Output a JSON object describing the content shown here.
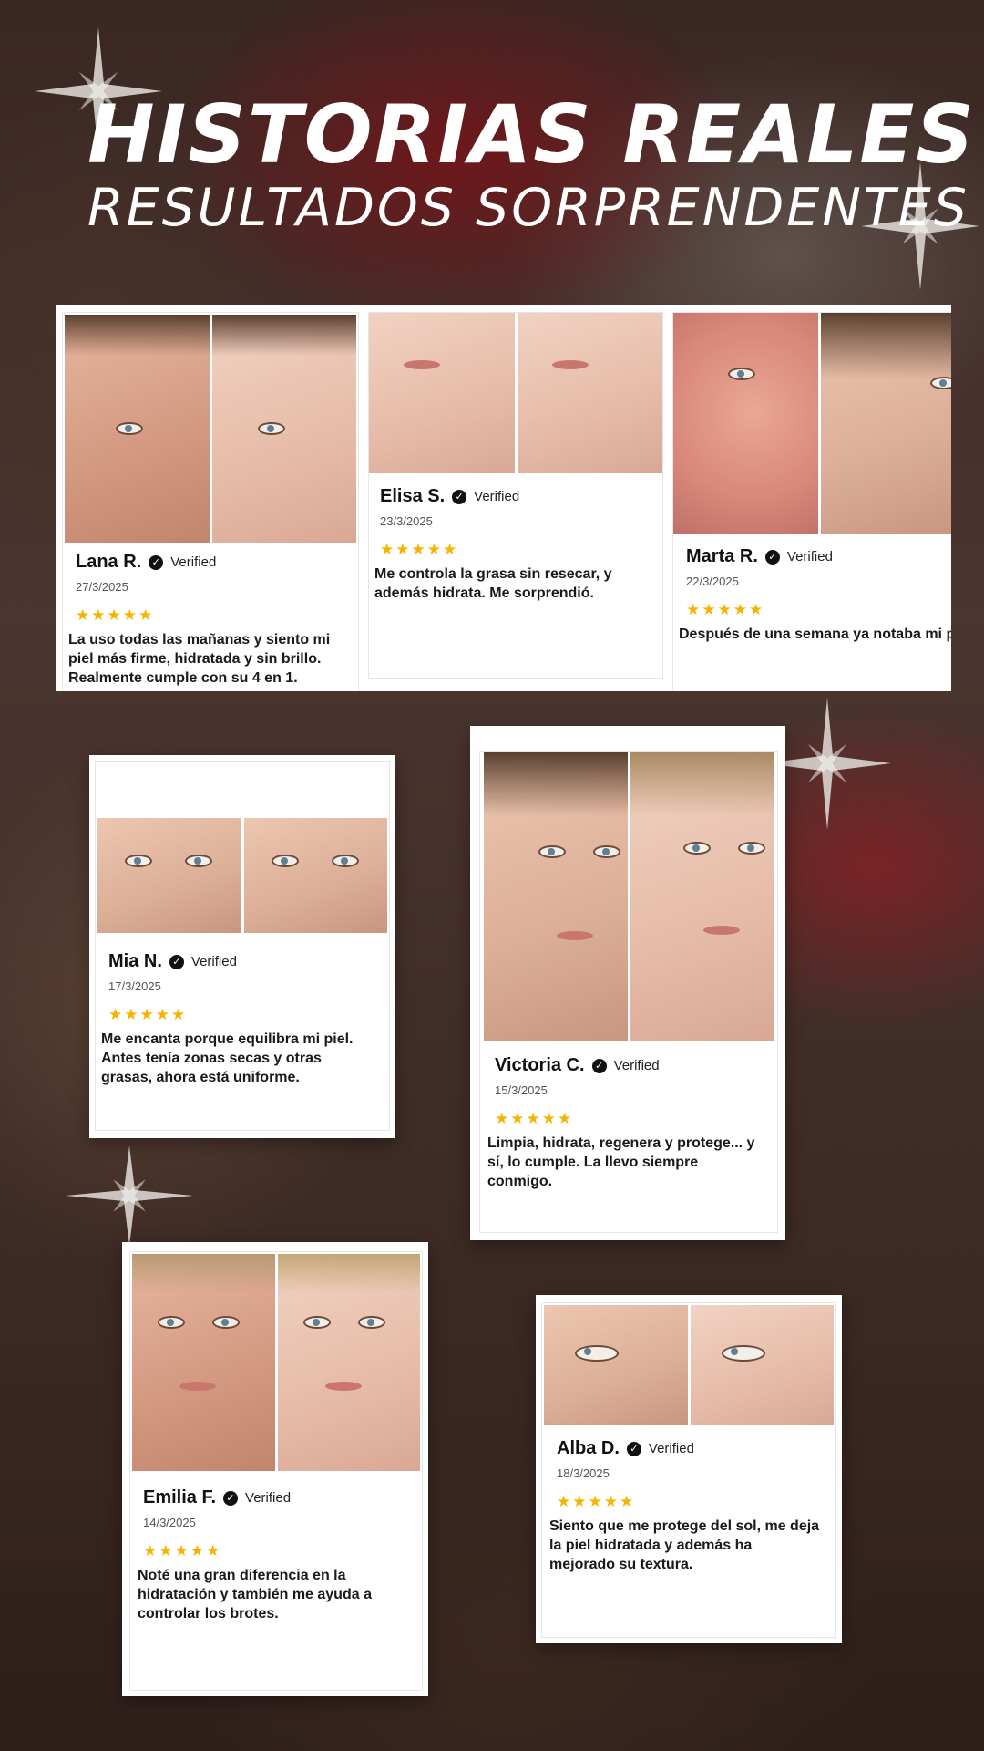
{
  "header": {
    "title": "HISTORIAS REALES",
    "subtitle": "RESULTADOS SORPRENDENTES"
  },
  "verified_label": "Verified",
  "colors": {
    "star_rating": "#f5b400",
    "title": "#ffffff",
    "card_bg": "#ffffff"
  },
  "reviews": [
    {
      "name": "Lana R.",
      "date": "27/3/2025",
      "rating": 5,
      "stars": "★★★★★",
      "text": "La uso todas las mañanas y siento mi piel más firme, hidratada y sin brillo. Realmente cumple con su 4 en 1."
    },
    {
      "name": "Elisa S.",
      "date": "23/3/2025",
      "rating": 5,
      "stars": "★★★★★",
      "text": "Me controla la grasa sin resecar, y además hidrata. Me sorprendió."
    },
    {
      "name": "Marta R.",
      "date": "22/3/2025",
      "rating": 5,
      "stars": "★★★★★",
      "text": "Después de una semana ya notaba mi piel más suave y con menos rojeces."
    },
    {
      "name": "Mia N.",
      "date": "17/3/2025",
      "rating": 5,
      "stars": "★★★★★",
      "text": "Me encanta porque equilibra mi piel. Antes tenía zonas secas y otras grasas, ahora está uniforme."
    },
    {
      "name": "Victoria C.",
      "date": "15/3/2025",
      "rating": 5,
      "stars": "★★★★★",
      "text": "Limpia, hidrata, regenera y protege... y sí, lo cumple. La llevo siempre conmigo."
    },
    {
      "name": "Emilia F.",
      "date": "14/3/2025",
      "rating": 5,
      "stars": "★★★★★",
      "text": "Noté una gran diferencia en la hidratación y también me ayuda a controlar los brotes."
    },
    {
      "name": "Alba D.",
      "date": "18/3/2025",
      "rating": 5,
      "stars": "★★★★★",
      "text": "Siento que me protege del sol, me deja la piel hidratada y además ha mejorado su textura."
    }
  ]
}
